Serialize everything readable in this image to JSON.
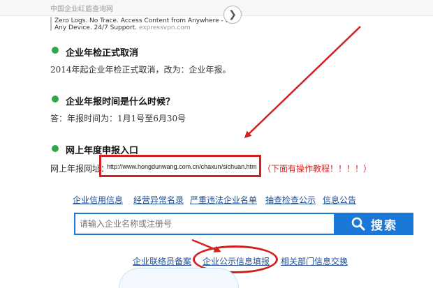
{
  "header": {
    "site_title": "中国企业红盾查询网"
  },
  "ad": {
    "line1": "Zero Logs. No Trace. Access Content from Anywhere - on",
    "line2_text": "Any Device. 24/7 Support.",
    "line2_url": "expressvpn.com",
    "arrow_glyph": "❯"
  },
  "sections": [
    {
      "heading": "企业年检正式取消",
      "body": "2014年起企业年检正式取消，改为：企业年报。"
    },
    {
      "heading": "企业年报时间是什么时候？",
      "body": "答：年报时间为：1月1号至6月30号"
    },
    {
      "heading": "网上年度申报入口",
      "body_label": "网上年报网址：",
      "url": "http://www.hongdunwang.com.cn/chaxun/sichuan.htm",
      "note": "（下面有操作教程！！！！）"
    }
  ],
  "nav_links": [
    {
      "label": "企业信用信息"
    },
    {
      "label": "经营异常名录"
    },
    {
      "label": "严重违法企业名单"
    },
    {
      "label": "抽查检查公示"
    },
    {
      "label": "信息公告"
    }
  ],
  "search": {
    "placeholder": "请输入企业名称或注册号",
    "button_label": "搜索"
  },
  "bottom_links": [
    {
      "label": "企业联络员备案"
    },
    {
      "label": "企业公示信息填报"
    },
    {
      "label": "相关部门信息交换"
    }
  ],
  "colors": {
    "accent_blue": "#1a78d6",
    "link_blue": "#1f4e96",
    "annotation_red": "#d41f1f",
    "bullet_green": "#2fa84a"
  }
}
